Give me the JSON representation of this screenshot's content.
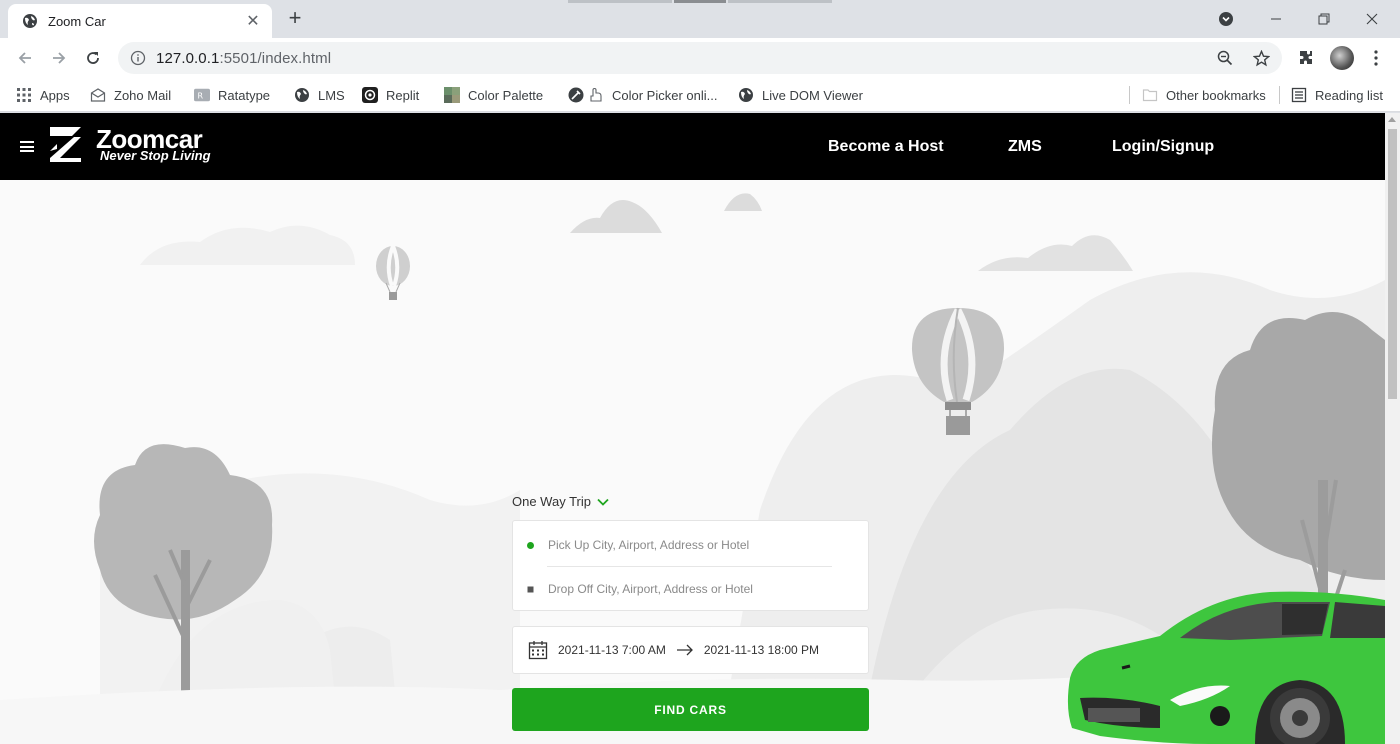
{
  "browser": {
    "tab": {
      "title": "Zoom Car",
      "favicon": "globe-icon"
    },
    "url": {
      "host": "127.0.0.1",
      "rest": ":5501/index.html"
    },
    "bookmarks": [
      {
        "label": "Apps",
        "icon": "apps-grid-icon"
      },
      {
        "label": "Zoho Mail",
        "icon": "mail-icon"
      },
      {
        "label": "Ratatype",
        "icon": "ratatype-icon"
      },
      {
        "label": "LMS",
        "icon": "globe-icon"
      },
      {
        "label": "Replit",
        "icon": "replit-icon"
      },
      {
        "label": "Color Palette",
        "icon": "palette-icon"
      },
      {
        "label": "Color Picker onli...",
        "icon": "color-picker-icon"
      },
      {
        "label": "Live DOM Viewer",
        "icon": "globe-icon"
      }
    ],
    "other_bookmarks": "Other bookmarks",
    "reading_list": "Reading list"
  },
  "site": {
    "brand": "Zoomcar",
    "tagline": "Never Stop Living",
    "nav": [
      "Become a Host",
      "ZMS",
      "Login/Signup"
    ]
  },
  "search": {
    "trip_type": "One Way Trip",
    "pickup_placeholder": "Pick Up City, Airport, Address or Hotel",
    "dropoff_placeholder": "Drop Off City, Airport, Address or Hotel",
    "start_datetime": "2021-11-13 7:00 AM",
    "end_datetime": "2021-11-13 18:00 PM",
    "find_button": "FIND CARS"
  },
  "colors": {
    "accent": "#1ea51e",
    "header_bg": "#000000",
    "car": "#3ec63e"
  }
}
